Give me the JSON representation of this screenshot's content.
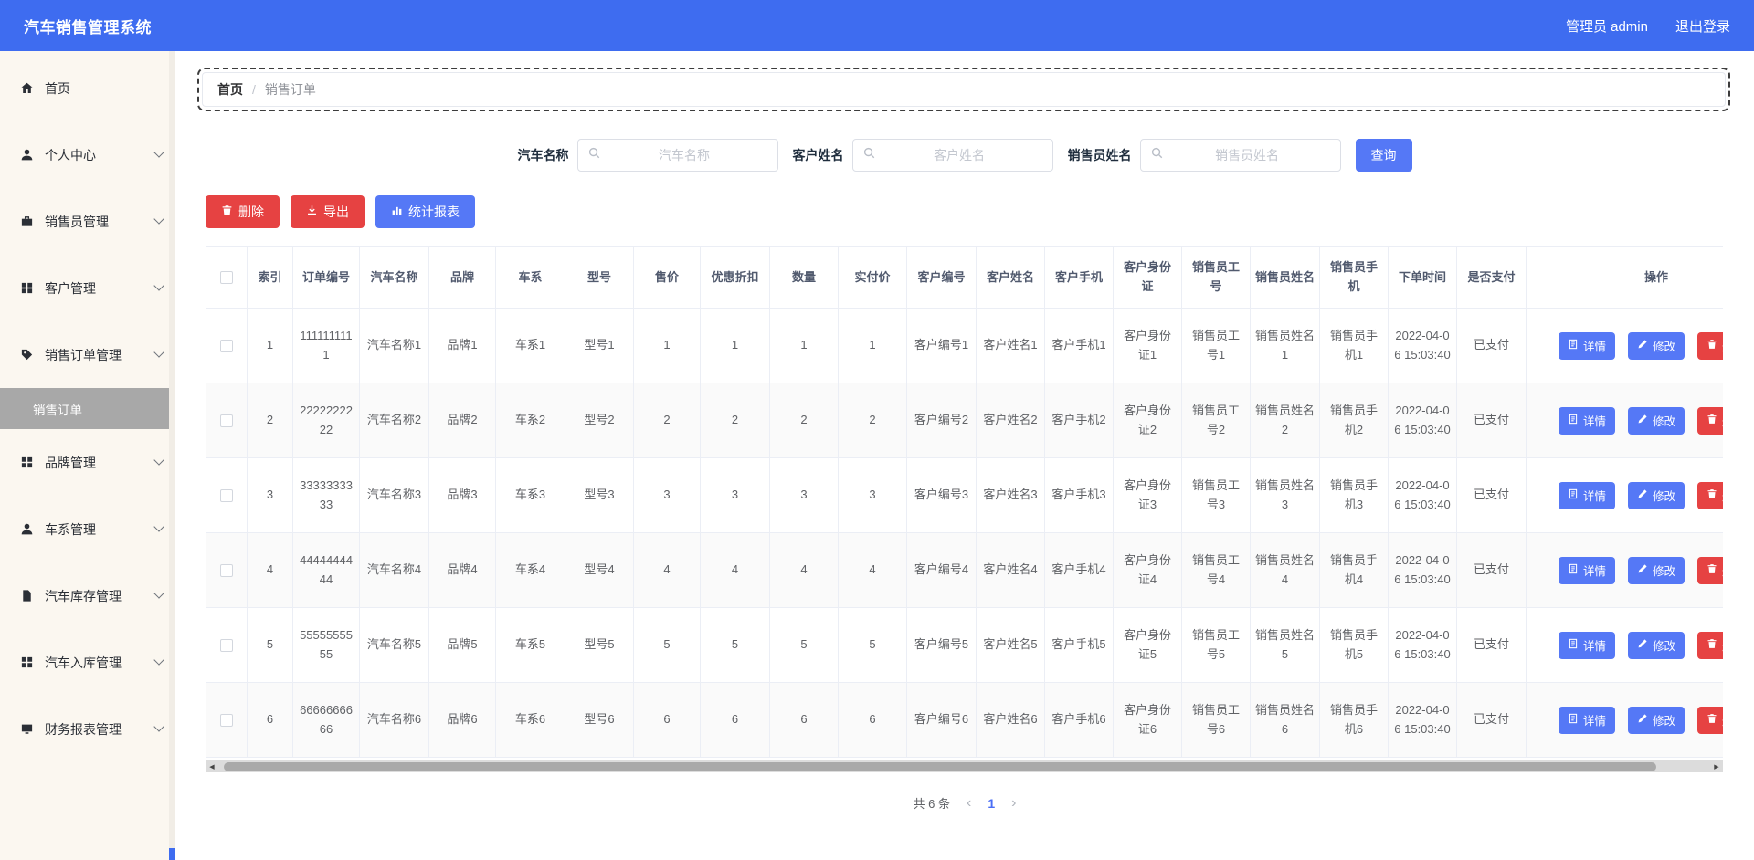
{
  "header": {
    "title": "汽车销售管理系统",
    "admin": "管理员 admin",
    "logout": "退出登录"
  },
  "sidebar": {
    "items": [
      {
        "label": "首页",
        "icon": "home-icon",
        "expandable": false
      },
      {
        "label": "个人中心",
        "icon": "user-icon",
        "expandable": true
      },
      {
        "label": "销售员管理",
        "icon": "briefcase-icon",
        "expandable": true
      },
      {
        "label": "客户管理",
        "icon": "grid-icon",
        "expandable": true
      },
      {
        "label": "销售订单管理",
        "icon": "tag-icon",
        "expandable": true,
        "expanded": true,
        "children": [
          {
            "label": "销售订单",
            "active": true
          }
        ]
      },
      {
        "label": "品牌管理",
        "icon": "grid-icon",
        "expandable": true
      },
      {
        "label": "车系管理",
        "icon": "user-icon",
        "expandable": true
      },
      {
        "label": "汽车库存管理",
        "icon": "document-icon",
        "expandable": true
      },
      {
        "label": "汽车入库管理",
        "icon": "grid-icon",
        "expandable": true
      },
      {
        "label": "财务报表管理",
        "icon": "monitor-icon",
        "expandable": true
      }
    ]
  },
  "breadcrumb": {
    "root": "首页",
    "separator": "/",
    "current": "销售订单"
  },
  "filters": {
    "fields": [
      {
        "label": "汽车名称",
        "placeholder": "汽车名称"
      },
      {
        "label": "客户姓名",
        "placeholder": "客户姓名"
      },
      {
        "label": "销售员姓名",
        "placeholder": "销售员姓名"
      }
    ],
    "search_label": "查询"
  },
  "toolbar": {
    "delete_label": "删除",
    "export_label": "导出",
    "report_label": "统计报表"
  },
  "table": {
    "columns": [
      "索引",
      "订单编号",
      "汽车名称",
      "品牌",
      "车系",
      "型号",
      "售价",
      "优惠折扣",
      "数量",
      "实付价",
      "客户编号",
      "客户姓名",
      "客户手机",
      "客户身份证",
      "销售员工号",
      "销售员姓名",
      "销售员手机",
      "下单时间",
      "是否支付",
      "操作"
    ],
    "action_labels": {
      "detail": "详情",
      "edit": "修改",
      "delete": "删除"
    },
    "rows": [
      {
        "index": 1,
        "order_no": "1111111111",
        "car_name": "汽车名称1",
        "brand": "品牌1",
        "series": "车系1",
        "model": "型号1",
        "price": 1,
        "discount": 1,
        "quantity": 1,
        "paid_amount": 1,
        "customer_no": "客户编号1",
        "customer_name": "客户姓名1",
        "customer_phone": "客户手机1",
        "customer_id_card": "客户身份证1",
        "salesman_no": "销售员工号1",
        "salesman_name": "销售员姓名1",
        "salesman_phone": "销售员手机1",
        "order_time": "2022-04-06 15:03:40",
        "pay_status": "已支付"
      },
      {
        "index": 2,
        "order_no": "2222222222",
        "car_name": "汽车名称2",
        "brand": "品牌2",
        "series": "车系2",
        "model": "型号2",
        "price": 2,
        "discount": 2,
        "quantity": 2,
        "paid_amount": 2,
        "customer_no": "客户编号2",
        "customer_name": "客户姓名2",
        "customer_phone": "客户手机2",
        "customer_id_card": "客户身份证2",
        "salesman_no": "销售员工号2",
        "salesman_name": "销售员姓名2",
        "salesman_phone": "销售员手机2",
        "order_time": "2022-04-06 15:03:40",
        "pay_status": "已支付"
      },
      {
        "index": 3,
        "order_no": "3333333333",
        "car_name": "汽车名称3",
        "brand": "品牌3",
        "series": "车系3",
        "model": "型号3",
        "price": 3,
        "discount": 3,
        "quantity": 3,
        "paid_amount": 3,
        "customer_no": "客户编号3",
        "customer_name": "客户姓名3",
        "customer_phone": "客户手机3",
        "customer_id_card": "客户身份证3",
        "salesman_no": "销售员工号3",
        "salesman_name": "销售员姓名3",
        "salesman_phone": "销售员手机3",
        "order_time": "2022-04-06 15:03:40",
        "pay_status": "已支付"
      },
      {
        "index": 4,
        "order_no": "4444444444",
        "car_name": "汽车名称4",
        "brand": "品牌4",
        "series": "车系4",
        "model": "型号4",
        "price": 4,
        "discount": 4,
        "quantity": 4,
        "paid_amount": 4,
        "customer_no": "客户编号4",
        "customer_name": "客户姓名4",
        "customer_phone": "客户手机4",
        "customer_id_card": "客户身份证4",
        "salesman_no": "销售员工号4",
        "salesman_name": "销售员姓名4",
        "salesman_phone": "销售员手机4",
        "order_time": "2022-04-06 15:03:40",
        "pay_status": "已支付"
      },
      {
        "index": 5,
        "order_no": "5555555555",
        "car_name": "汽车名称5",
        "brand": "品牌5",
        "series": "车系5",
        "model": "型号5",
        "price": 5,
        "discount": 5,
        "quantity": 5,
        "paid_amount": 5,
        "customer_no": "客户编号5",
        "customer_name": "客户姓名5",
        "customer_phone": "客户手机5",
        "customer_id_card": "客户身份证5",
        "salesman_no": "销售员工号5",
        "salesman_name": "销售员姓名5",
        "salesman_phone": "销售员手机5",
        "order_time": "2022-04-06 15:03:40",
        "pay_status": "已支付"
      },
      {
        "index": 6,
        "order_no": "6666666666",
        "car_name": "汽车名称6",
        "brand": "品牌6",
        "series": "车系6",
        "model": "型号6",
        "price": 6,
        "discount": 6,
        "quantity": 6,
        "paid_amount": 6,
        "customer_no": "客户编号6",
        "customer_name": "客户姓名6",
        "customer_phone": "客户手机6",
        "customer_id_card": "客户身份证6",
        "salesman_no": "销售员工号6",
        "salesman_name": "销售员姓名6",
        "salesman_phone": "销售员手机6",
        "order_time": "2022-04-06 15:03:40",
        "pay_status": "已支付"
      }
    ]
  },
  "pagination": {
    "total": "共 6 条",
    "prev": "‹",
    "page": "1",
    "next": "›"
  },
  "colors": {
    "header_blue": "#3e6cf0",
    "button_blue": "#5578f6",
    "danger_red": "#e64242",
    "active_submenu_bg": "#a8a8a8",
    "stripe_row": "#fafafa"
  }
}
